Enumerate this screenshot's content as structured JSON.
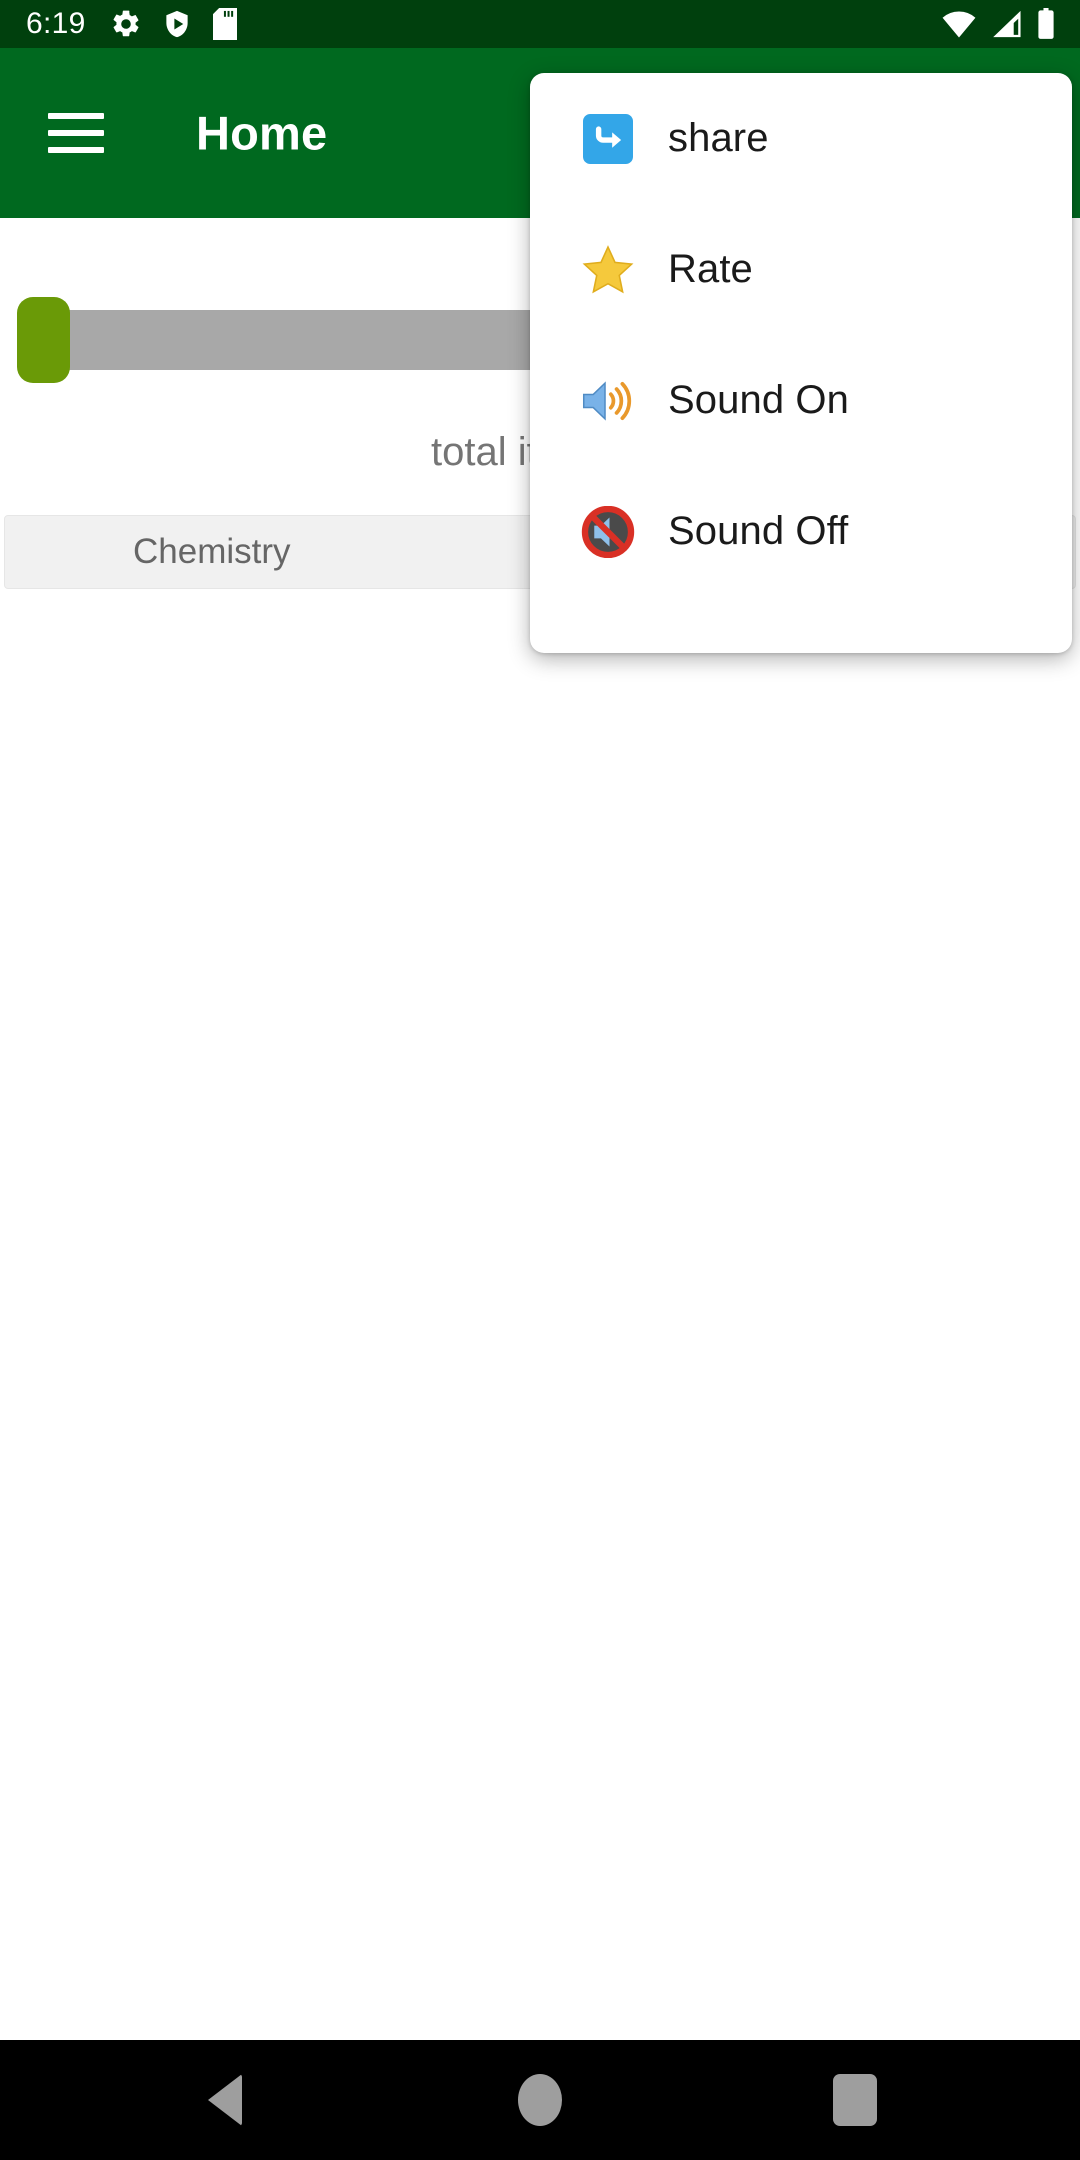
{
  "status_bar": {
    "time": "6:19",
    "left_icons": [
      "gear-icon",
      "play-protect-shield-icon",
      "sd-card-icon"
    ],
    "right_icons": [
      "wifi-icon",
      "cellular-signal-icon",
      "battery-icon"
    ],
    "background_color": "#00400d"
  },
  "app_bar": {
    "title": "Home",
    "menu_icon": "hamburger-menu-icon",
    "background_color": "#00691f",
    "text_color": "#ffffff"
  },
  "content": {
    "seekbar": {
      "name": "quantity-seekbar",
      "value_position_percent": 0,
      "thumb_color": "#6a9a07",
      "track_color": "#a8a8a8"
    },
    "total_label": "total item qu",
    "list_items": [
      {
        "label": "Chemistry",
        "background_color": "#f1f1f1",
        "text_color": "#666666"
      }
    ]
  },
  "popup_menu": {
    "background_color": "#ffffff",
    "items": [
      {
        "label": "share",
        "icon": "share-icon",
        "icon_color": "#33a6e8"
      },
      {
        "label": "Rate",
        "icon": "star-icon",
        "icon_color": "#f5c033"
      },
      {
        "label": "Sound On",
        "icon": "speaker-on-icon",
        "icon_color": "#6aaee8"
      },
      {
        "label": "Sound Off",
        "icon": "speaker-muted-icon",
        "icon_color": "#d93025"
      }
    ]
  },
  "nav_bar": {
    "background_color": "#000000",
    "buttons": [
      {
        "name": "back-button",
        "icon": "triangle-back-icon"
      },
      {
        "name": "home-button",
        "icon": "circle-home-icon"
      },
      {
        "name": "recents-button",
        "icon": "square-recents-icon"
      }
    ]
  }
}
